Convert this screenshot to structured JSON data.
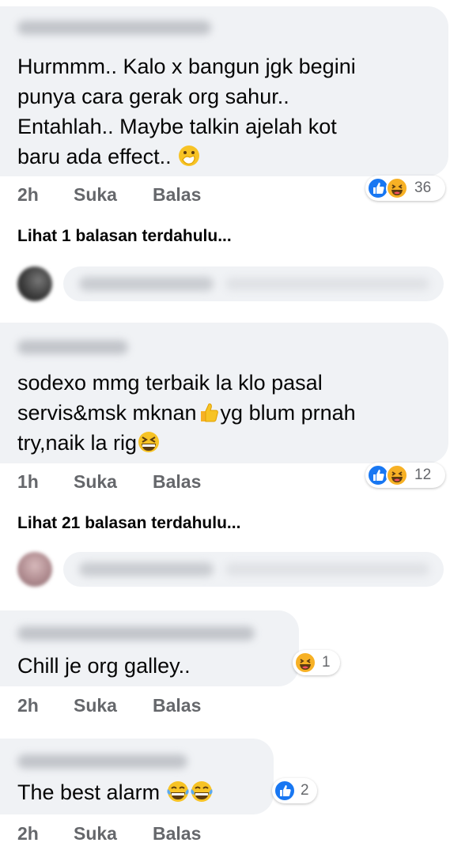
{
  "comments": [
    {
      "lines": [
        "Hurmmm.. Kalo x bangun jgk begini",
        "punya cara gerak org sahur..",
        "Entahlah.. Maybe talkin ajelah kot",
        "baru ada effect.."
      ],
      "trailing_emoji": "face-with-hand-over-mouth-icon",
      "time": "2h",
      "like": "Suka",
      "reply": "Balas",
      "reactions": {
        "types": [
          "like-icon",
          "haha-icon"
        ],
        "count": "36"
      }
    },
    {
      "lines": [
        "sodexo mmg terbaik la klo pasal",
        "servis&msk mknan",
        "yg blum prnah",
        "try,naik la rig"
      ],
      "time": "1h",
      "like": "Suka",
      "reply": "Balas",
      "reactions": {
        "types": [
          "like-icon",
          "haha-icon"
        ],
        "count": "12"
      }
    },
    {
      "lines": [
        "Chill je org galley.."
      ],
      "time": "2h",
      "like": "Suka",
      "reply": "Balas",
      "reactions": {
        "types": [
          "haha-icon"
        ],
        "count": "1"
      }
    },
    {
      "lines": [
        "The best alarm"
      ],
      "time": "2h",
      "like": "Suka",
      "reply": "Balas",
      "reactions": {
        "types": [
          "like-icon"
        ],
        "count": "2"
      }
    }
  ],
  "view_previous": [
    "Lihat 1 balasan terdahulu...",
    "Lihat 21 balasan terdahulu..."
  ],
  "colors": {
    "bubble": "#f0f2f5",
    "like_blue": "#1877f2",
    "haha_yellow": "#f7b125",
    "meta_gray": "#65676b"
  }
}
